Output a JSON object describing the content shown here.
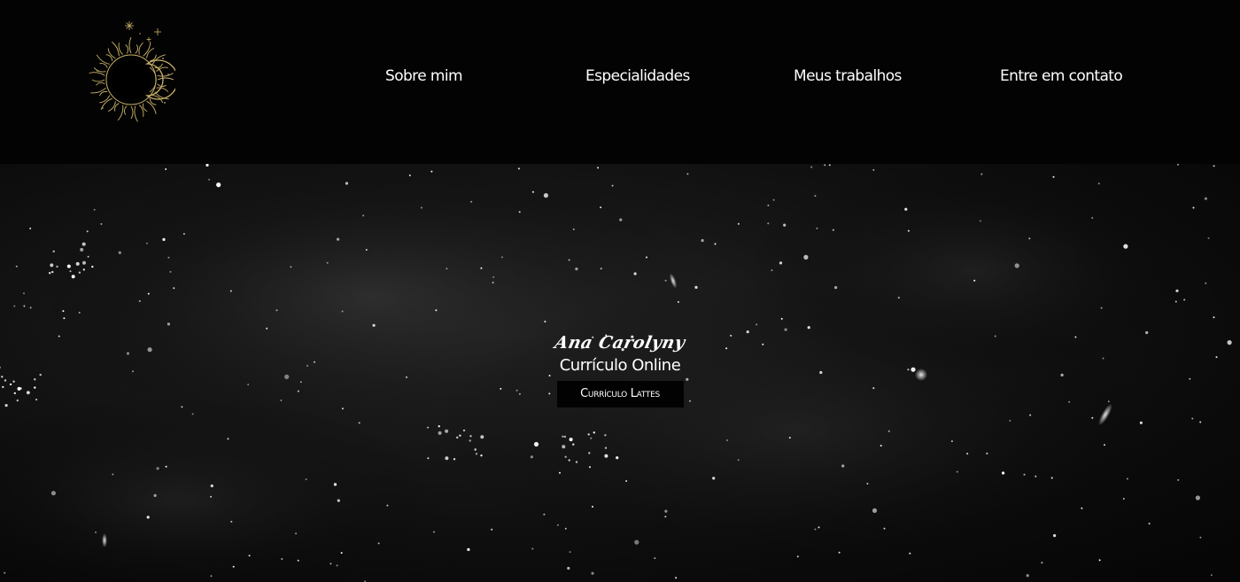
{
  "header": {
    "logo_icon": "sun-moon-icon",
    "nav": [
      {
        "label": "Sobre mim"
      },
      {
        "label": "Especialidades"
      },
      {
        "label": "Meus trabalhos"
      },
      {
        "label": "Entre em contato"
      }
    ]
  },
  "hero": {
    "background": "starfield-night-sky",
    "name": "Ana Carolyny",
    "subtitle": "Currículo Online",
    "button_label": "Currículo Lattes"
  },
  "colors": {
    "header_bg": "#030303",
    "text": "#ffffff",
    "logo_gold": "#c9b26a",
    "button_bg": "#020202"
  }
}
